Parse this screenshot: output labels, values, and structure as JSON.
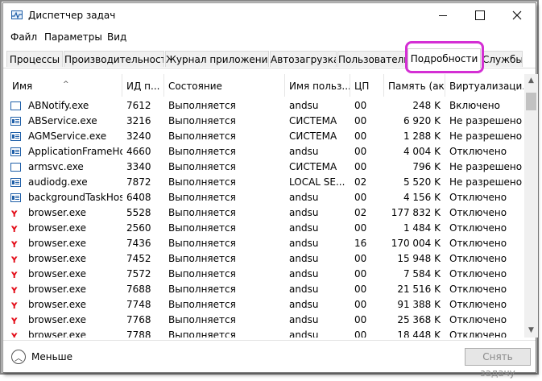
{
  "window": {
    "title": "Диспетчер задач"
  },
  "menu": [
    "Файл",
    "Параметры",
    "Вид"
  ],
  "tabs": [
    {
      "label": "Процессы"
    },
    {
      "label": "Производительность"
    },
    {
      "label": "Журнал приложений"
    },
    {
      "label": "Автозагрузка"
    },
    {
      "label": "Пользователи"
    },
    {
      "label": "Подробности",
      "active": true
    },
    {
      "label": "Службы"
    }
  ],
  "highlight_color": "#d42fd4",
  "columns": [
    "Имя",
    "ИД п...",
    "Состояние",
    "Имя польз...",
    "ЦП",
    "Память (акт...",
    "Виртуализаци..."
  ],
  "rows": [
    {
      "icon": "window-icon",
      "name": "ABNotify.exe",
      "pid": "7612",
      "state": "Выполняется",
      "user": "andsu",
      "cpu": "00",
      "mem": "248 K",
      "virt": "Включено"
    },
    {
      "icon": "service-icon",
      "name": "ABService.exe",
      "pid": "3216",
      "state": "Выполняется",
      "user": "СИСТЕМА",
      "cpu": "00",
      "mem": "6 920 K",
      "virt": "Не разрешено"
    },
    {
      "icon": "service-icon",
      "name": "AGMService.exe",
      "pid": "3240",
      "state": "Выполняется",
      "user": "СИСТЕМА",
      "cpu": "00",
      "mem": "1 288 K",
      "virt": "Не разрешено"
    },
    {
      "icon": "service-icon",
      "name": "ApplicationFrameHo...",
      "pid": "4660",
      "state": "Выполняется",
      "user": "andsu",
      "cpu": "00",
      "mem": "4 004 K",
      "virt": "Отключено"
    },
    {
      "icon": "window-icon",
      "name": "armsvc.exe",
      "pid": "3340",
      "state": "Выполняется",
      "user": "СИСТЕМА",
      "cpu": "00",
      "mem": "796 K",
      "virt": "Не разрешено"
    },
    {
      "icon": "service-icon",
      "name": "audiodg.exe",
      "pid": "7872",
      "state": "Выполняется",
      "user": "LOCAL SE...",
      "cpu": "02",
      "mem": "5 520 K",
      "virt": "Не разрешено"
    },
    {
      "icon": "service-icon",
      "name": "backgroundTaskHos...",
      "pid": "6408",
      "state": "Выполняется",
      "user": "andsu",
      "cpu": "00",
      "mem": "4 156 K",
      "virt": "Отключено"
    },
    {
      "icon": "yandex-icon",
      "name": "browser.exe",
      "pid": "5528",
      "state": "Выполняется",
      "user": "andsu",
      "cpu": "02",
      "mem": "177 832 K",
      "virt": "Отключено"
    },
    {
      "icon": "yandex-icon",
      "name": "browser.exe",
      "pid": "2560",
      "state": "Выполняется",
      "user": "andsu",
      "cpu": "00",
      "mem": "1 484 K",
      "virt": "Отключено"
    },
    {
      "icon": "yandex-icon",
      "name": "browser.exe",
      "pid": "7436",
      "state": "Выполняется",
      "user": "andsu",
      "cpu": "16",
      "mem": "170 004 K",
      "virt": "Отключено"
    },
    {
      "icon": "yandex-icon",
      "name": "browser.exe",
      "pid": "7452",
      "state": "Выполняется",
      "user": "andsu",
      "cpu": "00",
      "mem": "15 948 K",
      "virt": "Отключено"
    },
    {
      "icon": "yandex-icon",
      "name": "browser.exe",
      "pid": "7572",
      "state": "Выполняется",
      "user": "andsu",
      "cpu": "00",
      "mem": "7 584 K",
      "virt": "Отключено"
    },
    {
      "icon": "yandex-icon",
      "name": "browser.exe",
      "pid": "7688",
      "state": "Выполняется",
      "user": "andsu",
      "cpu": "00",
      "mem": "21 516 K",
      "virt": "Отключено"
    },
    {
      "icon": "yandex-icon",
      "name": "browser.exe",
      "pid": "7748",
      "state": "Выполняется",
      "user": "andsu",
      "cpu": "00",
      "mem": "91 388 K",
      "virt": "Отключено"
    },
    {
      "icon": "yandex-icon",
      "name": "browser.exe",
      "pid": "7768",
      "state": "Выполняется",
      "user": "andsu",
      "cpu": "00",
      "mem": "25 368 K",
      "virt": "Отключено"
    },
    {
      "icon": "yandex-icon",
      "name": "browser.exe",
      "pid": "7788",
      "state": "Выполняется",
      "user": "andsu",
      "cpu": "00",
      "mem": "18 448 K",
      "virt": "Отключено"
    }
  ],
  "footer": {
    "less_label": "Меньше",
    "end_task_label": "Снять задачу"
  }
}
